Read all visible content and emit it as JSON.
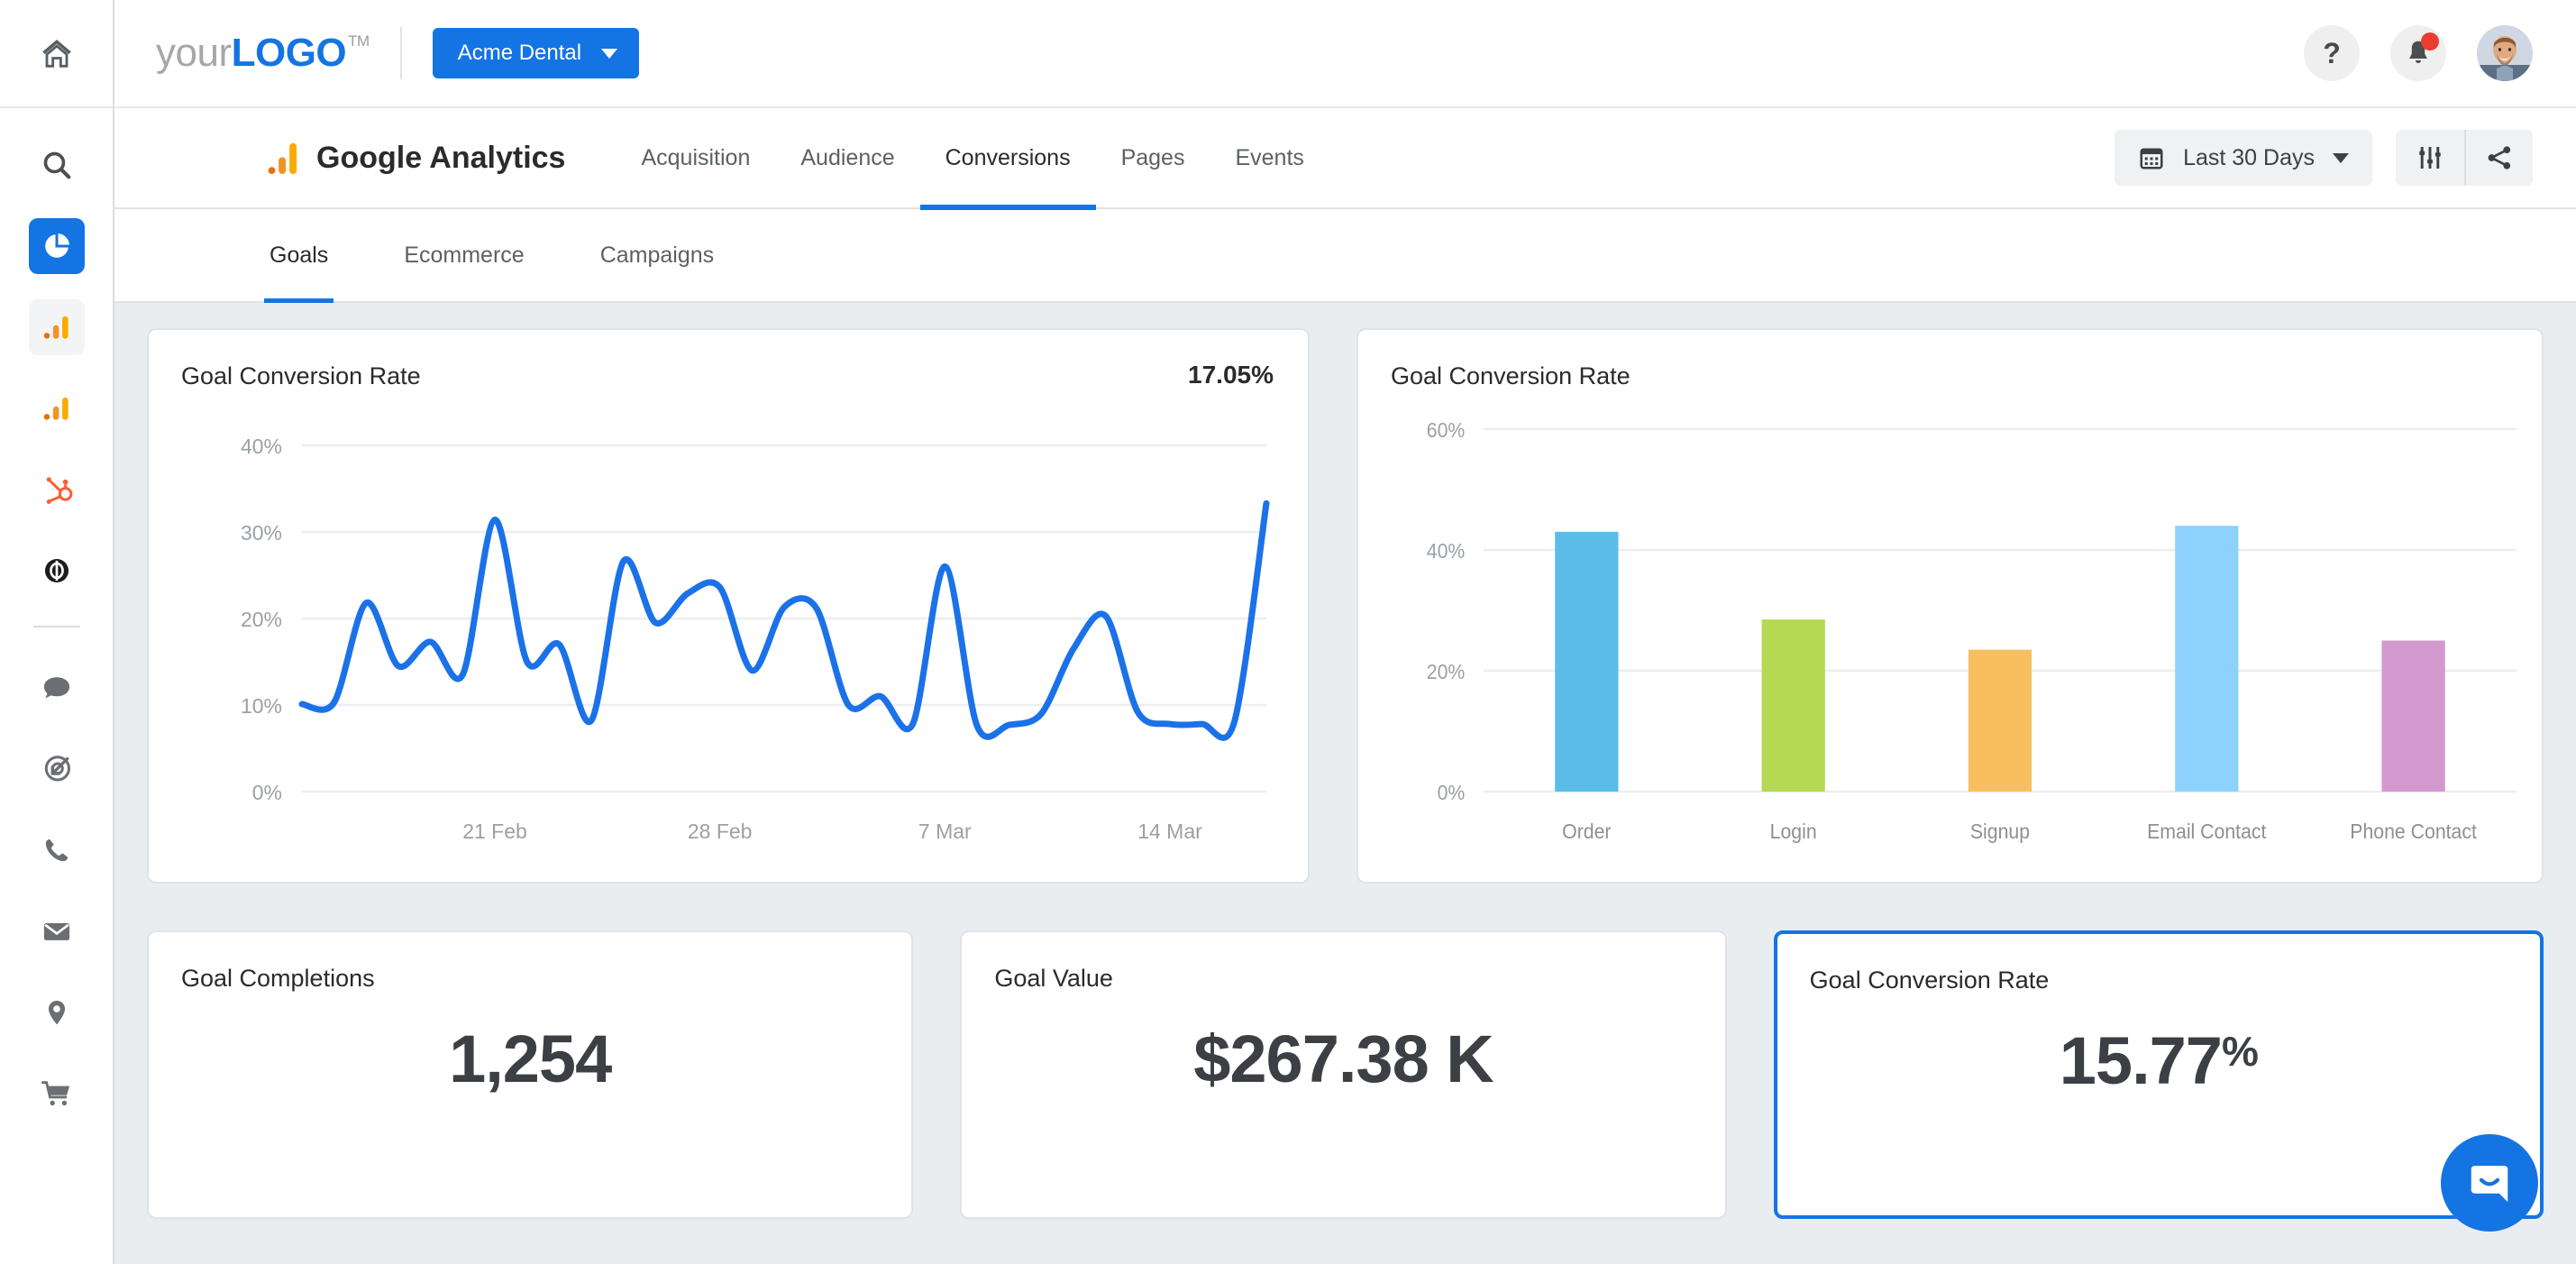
{
  "brand": {
    "logo_prefix": "your",
    "logo_bold": "LOGO",
    "logo_tm": "TM",
    "account_button": "Acme Dental"
  },
  "topbar": {
    "help_glyph": "?",
    "help_label": "Help",
    "notifications_label": "Notifications",
    "avatar_label": "User profile"
  },
  "nav": {
    "product_title": "Google Analytics",
    "tabs": [
      {
        "label": "Acquisition",
        "active": false
      },
      {
        "label": "Audience",
        "active": false
      },
      {
        "label": "Conversions",
        "active": true
      },
      {
        "label": "Pages",
        "active": false
      },
      {
        "label": "Events",
        "active": false
      }
    ],
    "date_range": "Last 30 Days",
    "settings_label": "Settings",
    "share_label": "Share"
  },
  "subtabs": [
    {
      "label": "Goals",
      "active": true
    },
    {
      "label": "Ecommerce",
      "active": false
    },
    {
      "label": "Campaigns",
      "active": false
    }
  ],
  "cards": {
    "line_card": {
      "title": "Goal Conversion Rate",
      "headline_value": "17.05%"
    },
    "bar_card": {
      "title": "Goal Conversion Rate"
    }
  },
  "kpis": [
    {
      "label": "Goal Completions",
      "value": "1,254",
      "suffix": "",
      "selected": false
    },
    {
      "label": "Goal Value",
      "value": "$267.38 K",
      "suffix": "",
      "selected": false
    },
    {
      "label": "Goal Conversion Rate",
      "value": "15.77",
      "suffix": "%",
      "selected": true
    }
  ],
  "sidebar": {
    "items": [
      {
        "name": "home-icon",
        "label": "Home",
        "state": "plain"
      },
      {
        "name": "search-icon",
        "label": "Search",
        "state": "plain"
      },
      {
        "name": "pie-chart-icon",
        "label": "Dashboards",
        "state": "active"
      },
      {
        "name": "analytics-bars-icon",
        "label": "Analytics",
        "state": "soft"
      },
      {
        "name": "analytics-bars-icon-2",
        "label": "Reports",
        "state": "plain"
      },
      {
        "name": "hubspot-icon",
        "label": "HubSpot",
        "state": "plain"
      },
      {
        "name": "compass-icon",
        "label": "Explore",
        "state": "plain"
      },
      {
        "name": "chat-bubble-icon",
        "label": "Messages",
        "state": "plain"
      },
      {
        "name": "target-icon",
        "label": "Campaigns",
        "state": "plain"
      },
      {
        "name": "phone-icon",
        "label": "Calls",
        "state": "plain"
      },
      {
        "name": "envelope-icon",
        "label": "Email",
        "state": "plain"
      },
      {
        "name": "location-pin-icon",
        "label": "Locations",
        "state": "plain"
      },
      {
        "name": "shopping-cart-icon",
        "label": "Commerce",
        "state": "plain"
      }
    ]
  },
  "chat": {
    "launcher_label": "Open chat"
  },
  "colors": {
    "accent": "#1474e4",
    "line_series": "#1b72e8",
    "badge_red": "#ea3d2f",
    "page_bg": "#eaedf0",
    "bar_order": "#5bbce8",
    "bar_login": "#b5d952",
    "bar_signup": "#f8bf61",
    "bar_email": "#8dd2fc",
    "bar_phone": "#d399ce",
    "ga_orange": "#f5a623",
    "ga_orange_dark": "#e8710a"
  },
  "chart_data": [
    {
      "id": "goal-conversion-rate-line",
      "type": "line",
      "title": "Goal Conversion Rate",
      "headline_value": "17.05%",
      "xlabel": "",
      "ylabel": "",
      "ylim": [
        0,
        40
      ],
      "yticks": [
        0,
        10,
        20,
        30,
        40
      ],
      "ytick_labels": [
        "0%",
        "10%",
        "20%",
        "30%",
        "40%"
      ],
      "xtick_labels": [
        "21 Feb",
        "28 Feb",
        "7 Mar",
        "14 Mar"
      ],
      "xtick_positions": [
        6,
        13,
        20,
        27
      ],
      "grid": true,
      "legend": "none",
      "series": [
        {
          "name": "Goal Conversion Rate",
          "color": "#1b72e8",
          "x": [
            0,
            1,
            2,
            3,
            4,
            5,
            6,
            7,
            8,
            9,
            10,
            11,
            12,
            13,
            14,
            15,
            16,
            17,
            18,
            19,
            20,
            21,
            22,
            23,
            24,
            25,
            26,
            27,
            28,
            29,
            30
          ],
          "values": [
            10.1,
            10.3,
            21.8,
            14.5,
            17.3,
            13.5,
            31.4,
            15.0,
            17.0,
            8.2,
            26.6,
            19.5,
            22.9,
            23.6,
            14.0,
            21.3,
            21.2,
            10.0,
            11.0,
            7.8,
            26.0,
            7.6,
            7.7,
            9.0,
            16.5,
            20.3,
            9.2,
            7.8,
            7.8,
            8.0,
            33.3
          ]
        }
      ]
    },
    {
      "id": "goal-conversion-rate-bar",
      "type": "bar",
      "title": "Goal Conversion Rate",
      "xlabel": "",
      "ylabel": "",
      "ylim": [
        0,
        60
      ],
      "yticks": [
        0,
        20,
        40,
        60
      ],
      "ytick_labels": [
        "0%",
        "20%",
        "40%",
        "60%"
      ],
      "grid": true,
      "legend": "none",
      "categories": [
        "Order",
        "Login",
        "Signup",
        "Email Contact",
        "Phone Contact"
      ],
      "values": [
        43.0,
        28.5,
        23.5,
        44.0,
        25.0
      ],
      "colors": [
        "#5bbce8",
        "#b5d952",
        "#f8bf61",
        "#8dd2fc",
        "#d399ce"
      ]
    }
  ]
}
